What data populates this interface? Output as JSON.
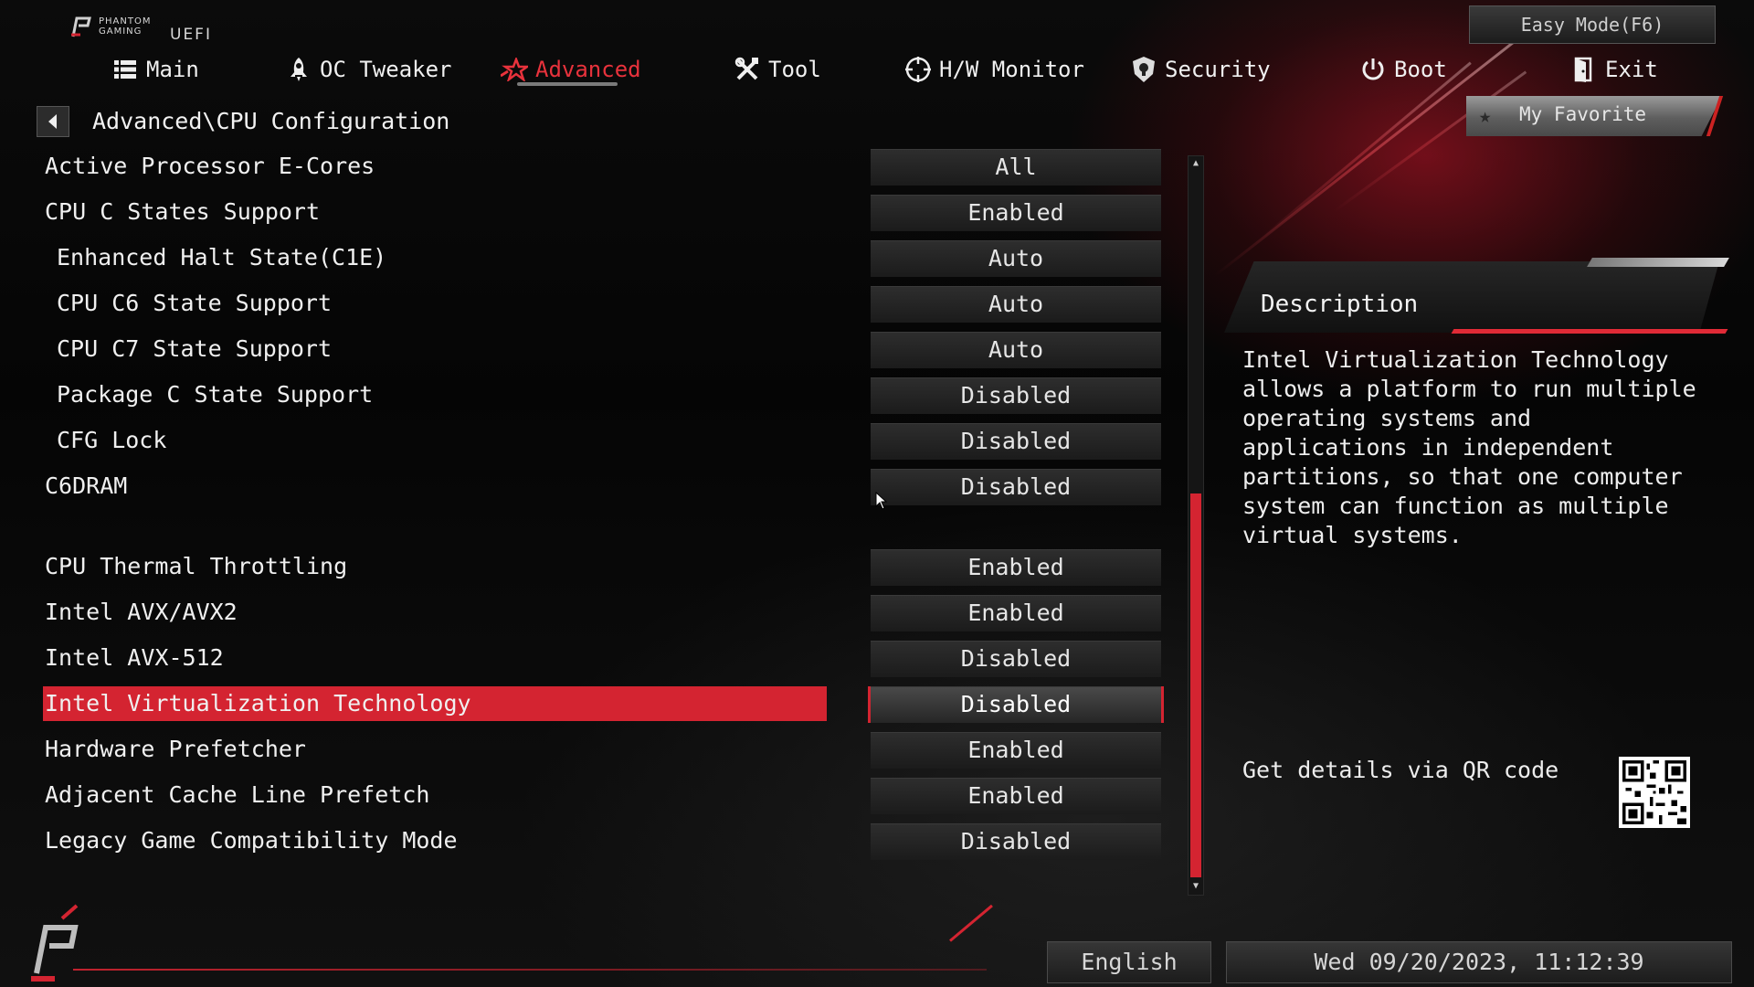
{
  "brand": {
    "logo_text_top": "PHANTOM",
    "logo_text_bottom": "GAMING",
    "uefi": "UEFI"
  },
  "easy_mode_label": "Easy Mode(F6)",
  "nav": [
    {
      "label": "Main",
      "icon": "list-icon"
    },
    {
      "label": "OC Tweaker",
      "icon": "rocket-icon"
    },
    {
      "label": "Advanced",
      "icon": "star-icon",
      "active": true
    },
    {
      "label": "Tool",
      "icon": "tools-icon"
    },
    {
      "label": "H/W Monitor",
      "icon": "crosshair-icon"
    },
    {
      "label": "Security",
      "icon": "shield-icon"
    },
    {
      "label": "Boot",
      "icon": "power-icon"
    },
    {
      "label": "Exit",
      "icon": "exit-door-icon"
    }
  ],
  "breadcrumb": "Advanced\\CPU Configuration",
  "my_favorite_label": "My Favorite",
  "settings": [
    {
      "label": "Active Processor E-Cores",
      "value": "All"
    },
    {
      "label": "CPU C States Support",
      "value": "Enabled"
    },
    {
      "label": "Enhanced Halt State(C1E)",
      "value": "Auto"
    },
    {
      "label": "CPU C6 State Support",
      "value": "Auto"
    },
    {
      "label": "CPU C7 State Support",
      "value": "Auto"
    },
    {
      "label": "Package C State Support",
      "value": "Disabled"
    },
    {
      "label": "CFG Lock",
      "value": "Disabled"
    },
    {
      "label": "C6DRAM",
      "value": "Disabled"
    },
    {
      "label": "CPU Thermal Throttling",
      "value": "Enabled"
    },
    {
      "label": "Intel AVX/AVX2",
      "value": "Enabled"
    },
    {
      "label": "Intel AVX-512",
      "value": "Disabled"
    },
    {
      "label": "Intel Virtualization Technology",
      "value": "Disabled",
      "selected": true
    },
    {
      "label": "Hardware Prefetcher",
      "value": "Enabled"
    },
    {
      "label": "Adjacent Cache Line Prefetch",
      "value": "Enabled"
    },
    {
      "label": "Legacy Game Compatibility Mode",
      "value": "Disabled"
    }
  ],
  "description": {
    "title": "Description",
    "text": "Intel Virtualization Technology allows a platform to run multiple operating systems and applications in independent partitions, so that one computer system can function as multiple virtual systems."
  },
  "qr_label": "Get details via QR code",
  "footer": {
    "language": "English",
    "datetime": "Wed 09/20/2023, 11:12:39"
  },
  "colors": {
    "accent_red": "#d42431",
    "text": "#f0f0f0",
    "background": "#070707"
  }
}
